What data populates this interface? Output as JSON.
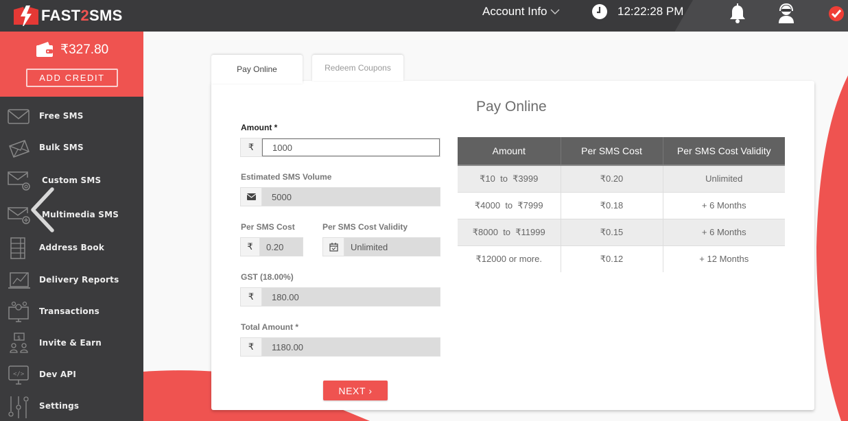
{
  "brand": {
    "name_part1": "FAST",
    "name_part2": "2",
    "name_part3": "SMS"
  },
  "topbar": {
    "account_label": "Account Info",
    "time": "12:22:28 PM"
  },
  "sidebar": {
    "balance": "₹327.80",
    "add_credit_label": "ADD CREDIT",
    "items": [
      {
        "label": "Free SMS",
        "icon": "envelope-icon"
      },
      {
        "label": "Bulk SMS",
        "icon": "envelopes-icon"
      },
      {
        "label": "Custom SMS",
        "icon": "envelope-gear-icon"
      },
      {
        "label": "Multimedia SMS",
        "icon": "envelope-plus-icon"
      },
      {
        "label": "Address Book",
        "icon": "address-book-icon"
      },
      {
        "label": "Delivery Reports",
        "icon": "chart-laptop-icon"
      },
      {
        "label": "Transactions",
        "icon": "monitor-coins-icon"
      },
      {
        "label": "Invite & Earn",
        "icon": "referral-icon"
      },
      {
        "label": "Dev API",
        "icon": "code-monitor-icon"
      },
      {
        "label": "Settings",
        "icon": "sliders-icon"
      }
    ]
  },
  "tabs": [
    {
      "label": "Pay Online",
      "active": true
    },
    {
      "label": "Redeem Coupons",
      "active": false
    }
  ],
  "form": {
    "title": "Pay Online",
    "amount_label": "Amount *",
    "amount_value": "1000",
    "currency_symbol": "₹",
    "volume_label": "Estimated SMS Volume",
    "volume_value": "5000",
    "per_sms_cost_label": "Per SMS Cost",
    "per_sms_cost_value": "0.20",
    "validity_label": "Per SMS Cost Validity",
    "validity_value": "Unlimited",
    "gst_label": "GST (18.00%)",
    "gst_value": "180.00",
    "total_label": "Total Amount *",
    "total_value": "1180.00",
    "next_label": "NEXT ›"
  },
  "rate_table": {
    "headers": [
      "Amount",
      "Per SMS Cost",
      "Per SMS Cost Validity"
    ],
    "rows": [
      [
        "₹10  to  ₹3999",
        "₹0.20",
        "Unlimited"
      ],
      [
        "₹4000  to  ₹7999",
        "₹0.18",
        "+ 6 Months"
      ],
      [
        "₹8000  to  ₹11999",
        "₹0.15",
        "+ 6 Months"
      ],
      [
        "₹12000 or more.",
        "₹0.12",
        "+ 12 Months"
      ]
    ]
  },
  "colors": {
    "brand_red": "#ef5350",
    "sidebar_bg": "#3b3b3d",
    "topbar_bg": "#3a3a3c",
    "table_header": "#616161"
  }
}
